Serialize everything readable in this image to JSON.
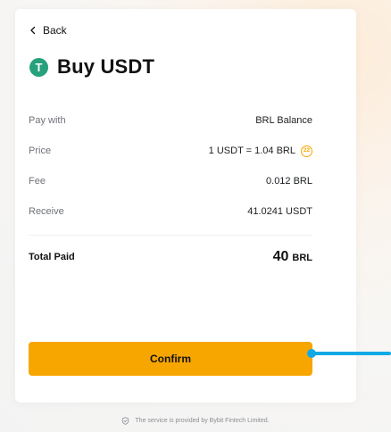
{
  "header": {
    "back_label": "Back",
    "title": "Buy USDT",
    "coin_letter": "T",
    "coin_color": "#26a17b"
  },
  "details": {
    "pay_with": {
      "label": "Pay with",
      "value": "BRL Balance"
    },
    "price": {
      "label": "Price",
      "value": "1 USDT = 1.04 BRL",
      "timer": "22"
    },
    "fee": {
      "label": "Fee",
      "value": "0.012 BRL"
    },
    "receive": {
      "label": "Receive",
      "value": "41.0241 USDT"
    }
  },
  "total": {
    "label": "Total Paid",
    "amount": "40",
    "currency": "BRL"
  },
  "confirm_label": "Confirm",
  "footer_text": "The service is provided by Bybit Fintech Limited.",
  "colors": {
    "accent": "#f7a600",
    "pointer": "#13a9e6",
    "tether": "#26a17b"
  },
  "icons": {
    "back": "chevron-left-icon",
    "coin": "tether-icon",
    "timer": "countdown-timer-icon",
    "footer": "shield-icon"
  }
}
